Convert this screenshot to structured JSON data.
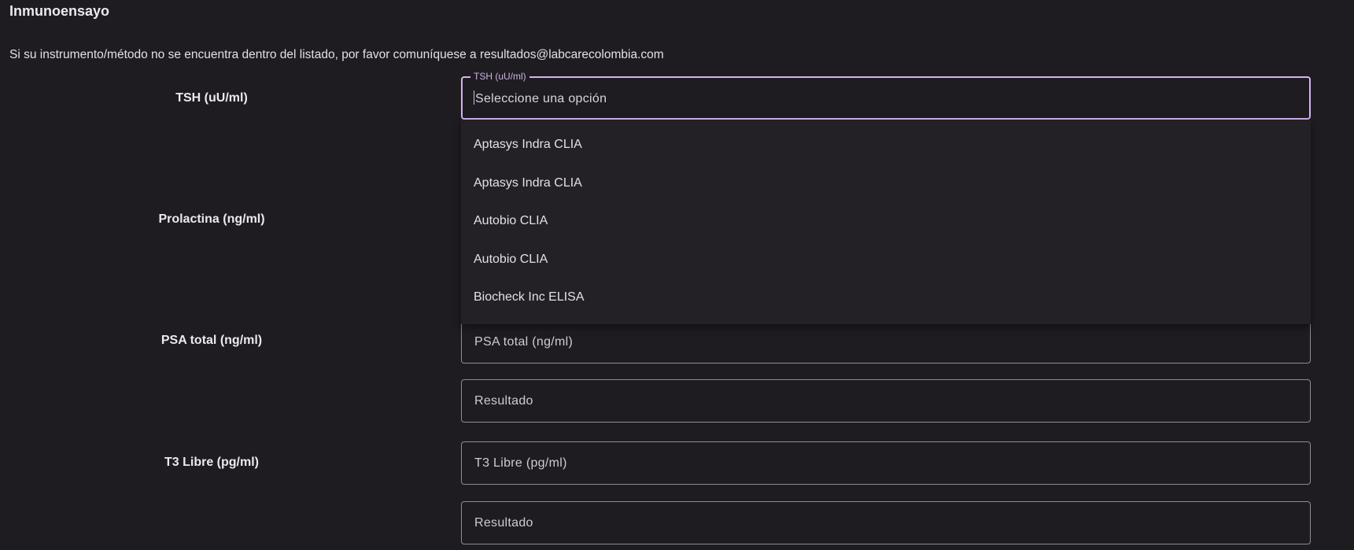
{
  "section": {
    "title": "Inmunoensayo",
    "notice": "Si su instrumento/método no se encuentra dentro del listado, por favor comuníquese a resultados@labcarecolombia.com"
  },
  "tsh": {
    "label": "TSH (uU/ml)",
    "float_label": "TSH (uU/ml)",
    "value": "Seleccione una opción",
    "options": [
      "Aptasys Indra CLIA",
      "Aptasys Indra CLIA",
      "Autobio CLIA",
      "Autobio CLIA",
      "Biocheck Inc ELISA"
    ]
  },
  "prolactina": {
    "label": "Prolactina (ng/ml)"
  },
  "psa": {
    "label": "PSA total (ng/ml)",
    "select_placeholder": "PSA total (ng/ml)",
    "result_placeholder": "Resultado"
  },
  "t3": {
    "label": "T3 Libre (pg/ml)",
    "select_placeholder": "T3 Libre (pg/ml)",
    "result_placeholder": "Resultado"
  },
  "colors": {
    "background": "#1e1c21",
    "focus_accent": "#d7b4f0",
    "field_border": "#8f8a94",
    "menu_surface": "#232126"
  }
}
